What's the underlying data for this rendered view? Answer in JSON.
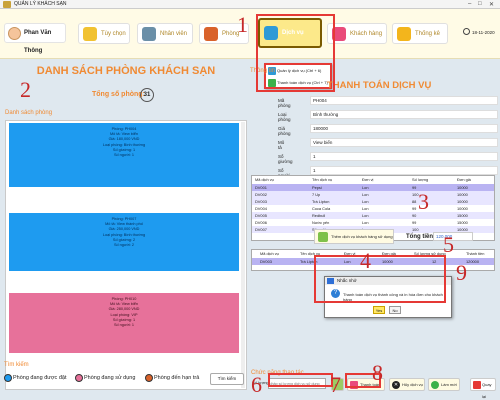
{
  "window": {
    "title": "QUẢN LÝ KHÁCH SẠN",
    "minimize": "–",
    "maximize": "□",
    "close": "✕"
  },
  "user": {
    "name": "Phan Văn Thông"
  },
  "nav": [
    {
      "label": "Tùy chọn"
    },
    {
      "label": "Nhân viên"
    },
    {
      "label": "Phòng"
    },
    {
      "label": "Dịch vụ"
    },
    {
      "label": "Khách hàng"
    },
    {
      "label": "Thống kê"
    }
  ],
  "date": "18-11-2020",
  "service_menu": {
    "items": [
      {
        "label": "Quản lý dịch vụ (Ctrl + 6)"
      },
      {
        "label": "Thanh toán dịch vụ (Ctrl + 7)"
      }
    ]
  },
  "left": {
    "title": "DANH SÁCH PHÒNG KHÁCH SẠN",
    "total_label": "Tổng số phòng:",
    "total_value": "31",
    "list_label": "Danh sách phòng",
    "rooms": [
      {
        "lines": [
          "Phòng: PH004",
          "Mô tả: View biển",
          "Giá: 180,000 VND",
          "Loại phòng: Bình thường",
          "Số giường: 1",
          "Số người: 1"
        ]
      },
      {
        "lines": [
          "Phòng: PH007",
          "Mô tả: View thành phố",
          "Giá: 250,000 VND",
          "Loại phòng: Bình thường",
          "Số giường: 2",
          "Số người: 2"
        ]
      },
      {
        "lines": [
          "Phòng: PH010",
          "Mô tả: View biển",
          "Giá: 280,000 VND",
          "Loại phòng: VIP",
          "Số giường: 1",
          "Số người: 1"
        ]
      }
    ],
    "search_label": "Tìm kiếm",
    "legend": [
      "Phòng đang được đặt",
      "Phòng đang sử dụng",
      "Phòng đến hạn trả"
    ],
    "search_button": "Tìm kiếm"
  },
  "right": {
    "info_label": "Thông tin",
    "title": "THANH TOÁN DỊCH VỤ",
    "fields": [
      {
        "label": "Mã phòng",
        "value": "PH004"
      },
      {
        "label": "Loại phòng",
        "value": "Bình thường"
      },
      {
        "label": "Giá phòng",
        "value": "180000"
      },
      {
        "label": "Mô tả",
        "value": "View biển"
      },
      {
        "label": "Số giường",
        "value": "1"
      },
      {
        "label": "Số người",
        "value": "1"
      }
    ],
    "services_table": {
      "headers": [
        "Mã dịch vụ",
        "Tên dịch vụ",
        "Đơn vị",
        "Số lượng",
        "Đơn giá"
      ],
      "rows": [
        [
          "DV001",
          "Pepsi",
          "Lon",
          "99",
          "10000"
        ],
        [
          "DV002",
          "7 Up",
          "Lon",
          "100",
          "10000"
        ],
        [
          "DV003",
          "Trà Lipton",
          "Lon",
          "88",
          "10000"
        ],
        [
          "DV004",
          "Coca Cola",
          "Lon",
          "99",
          "10000"
        ],
        [
          "DV005",
          "Redbull",
          "Lon",
          "90",
          "15000"
        ],
        [
          "DV006",
          "Nước yến",
          "Lon",
          "99",
          "15000"
        ],
        [
          "DV007",
          "Sting dâu",
          "Lon",
          "100",
          "10000"
        ]
      ]
    },
    "add_button": "Thêm dịch vụ khách hàng sử dụng",
    "total_label": "Tổng tiền:",
    "total_value": "120.000",
    "used_table": {
      "headers": [
        "Mã dịch vụ",
        "Tên dịch vụ",
        "Đơn vị",
        "Đơn giá",
        "Số lượng sử dụng",
        "Thành tiền"
      ],
      "rows": [
        [
          "DV003",
          "Trà Lipton",
          "Lon",
          "10000",
          "12",
          "120000"
        ]
      ]
    },
    "dialog": {
      "title": "Nhắc nhở",
      "message": "Thanh toán dịch vụ thành công và in hóa đơn cho khách hàng",
      "yes": "Yes",
      "no": "No"
    },
    "actions_label": "Chức năng thao tác",
    "quantity_label": "Số lượng",
    "quantity_placeholder": "Nhập số lượng dịch vụ sử dụng",
    "pay_button": "Thanh toán",
    "cancel_button": "Hủy dịch vụ",
    "refresh_button": "Làm mới",
    "back_button": "Quay lại"
  },
  "annotations": [
    "1",
    "2",
    "3",
    "4",
    "5",
    "6",
    "7",
    "8",
    "9"
  ]
}
